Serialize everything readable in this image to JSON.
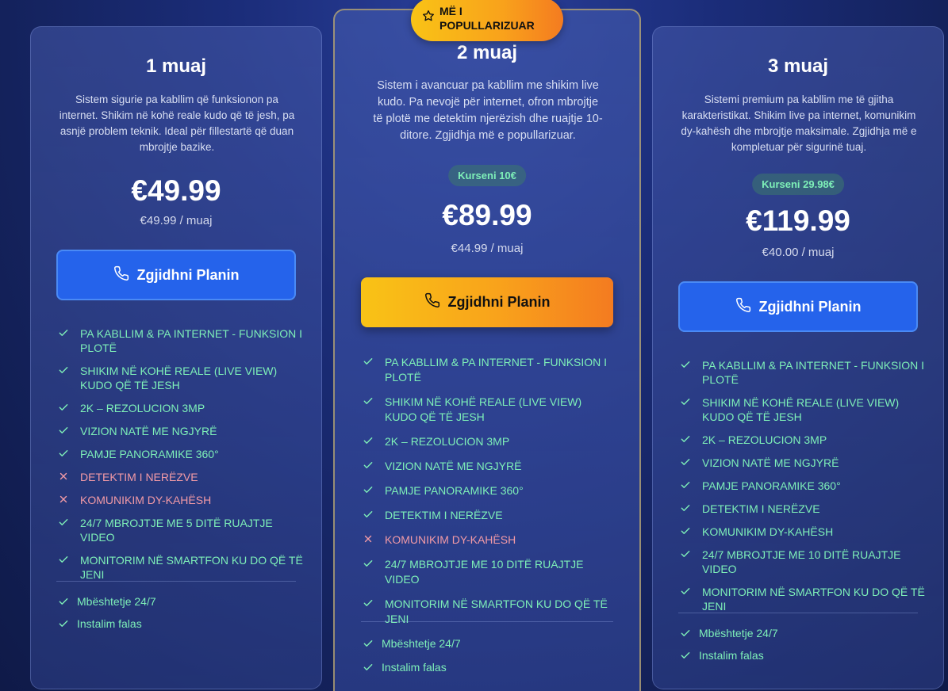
{
  "popular_badge": {
    "label": "MË I POPULLARIZUAR",
    "icon": "star-icon"
  },
  "colors": {
    "accent_blue": "#2563eb",
    "accent_gold": "#f9a21b",
    "check_green": "#7ef0b8",
    "cross_red": "#f29aa6"
  },
  "plans": [
    {
      "title": "1 muaj",
      "description": "Sistem sigurie pa kabllim që funksionon pa internet. Shikim në kohë reale kudo që të jesh, pa asnjë problem teknik. Ideal për fillestartë që duan mbrojtje bazike.",
      "discount": "",
      "price": "€49.99",
      "per_month": "€49.99 / muaj",
      "cta": "Zgjidhni Planin",
      "features": [
        {
          "text": "PA KABLLIM & PA INTERNET - FUNKSION I PLOTË",
          "included": true
        },
        {
          "text": "SHIKIM NË KOHË REALE (LIVE VIEW) KUDO QË TË JESH",
          "included": true
        },
        {
          "text": "2K – REZOLUCION 3MP",
          "included": true
        },
        {
          "text": "VIZION NATË ME NGJYRË",
          "included": true
        },
        {
          "text": "PAMJE PANORAMIKE 360°",
          "included": true
        },
        {
          "text": "DETEKTIM I NERËZVE",
          "included": false
        },
        {
          "text": "KOMUNIKIM DY-KAHËSH",
          "included": false
        },
        {
          "text": "24/7 MBROJTJE ME 5 DITË RUAJTJE VIDEO",
          "included": true
        },
        {
          "text": "MONITORIM NË SMARTFON KU DO QË TË JENI",
          "included": true
        }
      ],
      "extras": [
        "Mbështetje 24/7",
        "Instalim falas"
      ]
    },
    {
      "title": "2 muaj",
      "description": "Sistem i avancuar pa kabllim me shikim live kudo. Pa nevojë për internet, ofron mbrojtje të plotë me detektim njerëzish dhe ruajtje 10-ditore. Zgjidhja më e popullarizuar.",
      "discount": "Kurseni 10€",
      "price": "€89.99",
      "per_month": "€44.99 / muaj",
      "cta": "Zgjidhni Planin",
      "features": [
        {
          "text": "PA KABLLIM & PA INTERNET - FUNKSION I PLOTË",
          "included": true
        },
        {
          "text": "SHIKIM NË KOHË REALE (LIVE VIEW) KUDO QË TË JESH",
          "included": true
        },
        {
          "text": "2K – REZOLUCION 3MP",
          "included": true
        },
        {
          "text": "VIZION NATË ME NGJYRË",
          "included": true
        },
        {
          "text": "PAMJE PANORAMIKE 360°",
          "included": true
        },
        {
          "text": "DETEKTIM I NERËZVE",
          "included": true
        },
        {
          "text": "KOMUNIKIM DY-KAHËSH",
          "included": false
        },
        {
          "text": "24/7 MBROJTJE ME 10 DITË RUAJTJE VIDEO",
          "included": true
        },
        {
          "text": "MONITORIM NË SMARTFON KU DO QË TË JENI",
          "included": true
        }
      ],
      "extras": [
        "Mbështetje 24/7",
        "Instalim falas"
      ]
    },
    {
      "title": "3 muaj",
      "description": "Sistemi premium pa kabllim me të gjitha karakteristikat. Shikim live pa internet, komunikim dy-kahësh dhe mbrojtje maksimale. Zgjidhja më e kompletuar për sigurinë tuaj.",
      "discount": "Kurseni 29.98€",
      "price": "€119.99",
      "per_month": "€40.00 / muaj",
      "cta": "Zgjidhni Planin",
      "features": [
        {
          "text": "PA KABLLIM & PA INTERNET - FUNKSION I PLOTË",
          "included": true
        },
        {
          "text": "SHIKIM NË KOHË REALE (LIVE VIEW) KUDO QË TË JESH",
          "included": true
        },
        {
          "text": "2K – REZOLUCION 3MP",
          "included": true
        },
        {
          "text": "VIZION NATË ME NGJYRË",
          "included": true
        },
        {
          "text": "PAMJE PANORAMIKE 360°",
          "included": true
        },
        {
          "text": "DETEKTIM I NERËZVE",
          "included": true
        },
        {
          "text": "KOMUNIKIM DY-KAHËSH",
          "included": true
        },
        {
          "text": "24/7 MBROJTJE ME 10 DITË RUAJTJE VIDEO",
          "included": true
        },
        {
          "text": "MONITORIM NË SMARTFON KU DO QË TË JENI",
          "included": true
        }
      ],
      "extras": [
        "Mbështetje 24/7",
        "Instalim falas"
      ]
    }
  ]
}
